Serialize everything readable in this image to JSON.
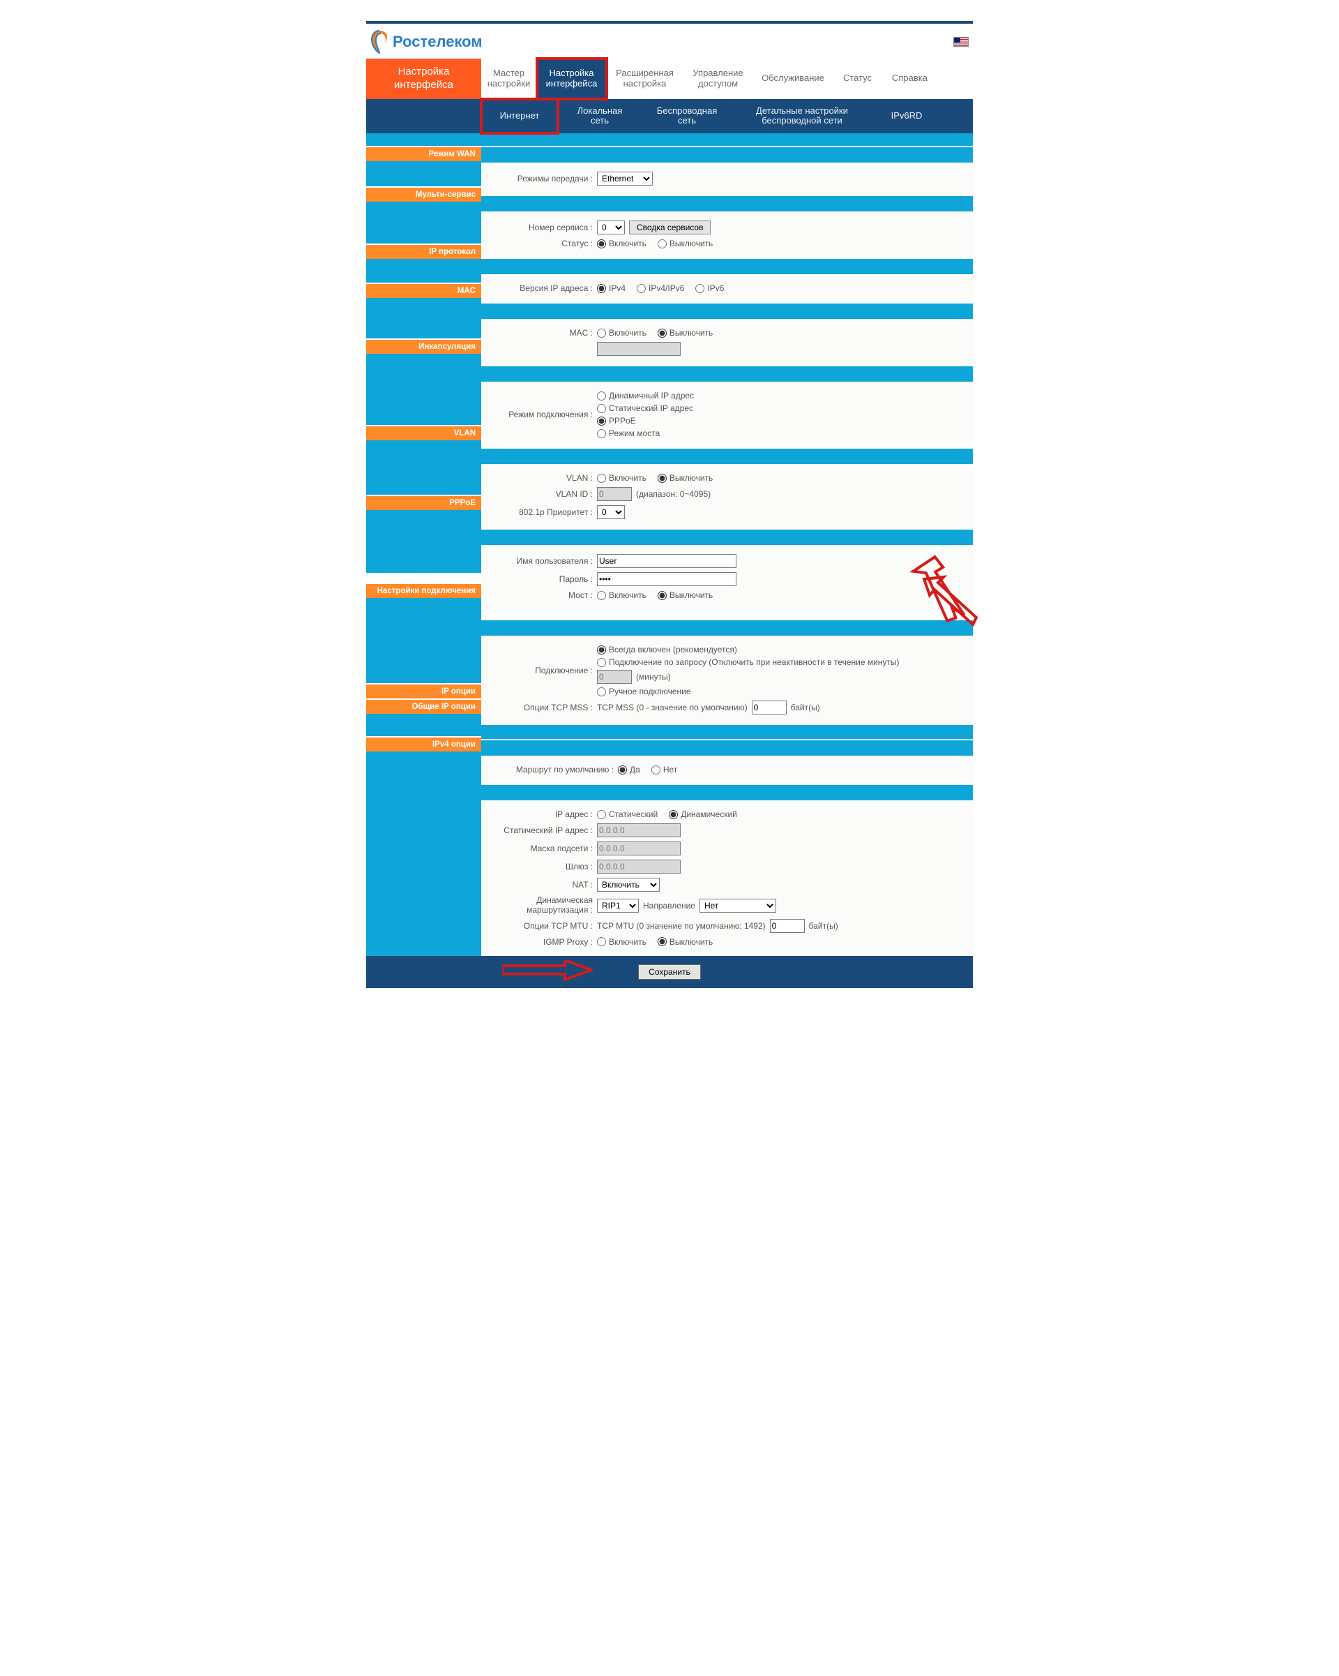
{
  "logo_text": "Ростелеком",
  "left_title_l1": "Настройка",
  "left_title_l2": "интерфейса",
  "main_tabs": {
    "t1_l1": "Мастер",
    "t1_l2": "настройки",
    "t2_l1": "Настройка",
    "t2_l2": "интерфейса",
    "t3_l1": "Расширенная",
    "t3_l2": "настройка",
    "t4_l1": "Управление",
    "t4_l2": "доступом",
    "t5": "Обслуживание",
    "t6": "Статус",
    "t7": "Справка"
  },
  "sub_tabs": {
    "s1": "Интернет",
    "s2_l1": "Локальная",
    "s2_l2": "сеть",
    "s3_l1": "Беспроводная",
    "s3_l2": "сеть",
    "s4_l1": "Детальные настройки",
    "s4_l2": "беспроводной сети",
    "s5": "IPv6RD"
  },
  "sections": {
    "wan": "Режим WAN",
    "multi": "Мульти-сервис",
    "ipproto": "IP протокол",
    "mac": "MAC",
    "encap": "Инкапсуляция",
    "vlan": "VLAN",
    "pppoe": "PPPoE",
    "conn": "Настройки подключения",
    "ipopt": "IP опции",
    "ipopt_common": "Общие IP опции",
    "ipv4opt": "IPv4 опции"
  },
  "labels": {
    "transfer_modes": "Режимы передачи :",
    "service_number": "Номер сервиса :",
    "service_summary_btn": "Сводка сервисов",
    "status": "Статус :",
    "enable": "Включить",
    "disable": "Выключить",
    "ip_version": "Версия IP адреса :",
    "ipv4": "IPv4",
    "ipv4ipv6": "IPv4/IPv6",
    "ipv6": "IPv6",
    "mac": "MAC :",
    "conn_mode": "Режим подключения :",
    "dyn_ip": "Динамичный IP адрес",
    "stat_ip": "Статический IP адрес",
    "pppoe": "PPPoE",
    "bridge_mode": "Режим моста",
    "vlan": "VLAN :",
    "vlan_id": "VLAN ID :",
    "vlan_range": "(диапазон: 0~4095)",
    "priority": "802.1p Приоритет :",
    "username": "Имя пользователя :",
    "password": "Пароль :",
    "bridge": "Мост :",
    "connection": "Подключение :",
    "always_on": "Всегда включен (рекомендуется)",
    "on_demand": "Подключение по запросу (Отключить при неактивности в течение минуты)",
    "minutes_suffix": "(минуты)",
    "manual_conn": "Ручное подключение",
    "tcp_mss_opts": "Опции TCP MSS :",
    "tcp_mss_text": "TCP MSS (0 - значение по умолчанию)",
    "bytes": "байт(ы)",
    "default_route": "Маршрут по умолчанию :",
    "yes": "Да",
    "no": "Нет",
    "ip_addr": "IP адрес :",
    "static": "Статический",
    "dynamic": "Динамический",
    "static_ip_addr": "Статический IP адрес :",
    "subnet_mask": "Маска подсети :",
    "gateway": "Шлюз :",
    "nat": "NAT :",
    "dyn_routing_l1": "Динамическая",
    "dyn_routing_l2": "маршрутизация",
    "direction": "Направление",
    "tcp_mtu_opts": "Опции TCP MTU :",
    "tcp_mtu_text": "TCP MTU (0 значение по умолчанию: 1492)",
    "igmp_proxy": "IGMP Proxy :",
    "save_btn": "Сохранить"
  },
  "values": {
    "transfer_mode_selected": "Ethernet",
    "service_number_selected": "0",
    "priority_selected": "0",
    "vlan_id": "0",
    "username": "User",
    "password": "••••",
    "idle_minutes": "0",
    "tcp_mss": "0",
    "static_ip": "0.0.0.0",
    "subnet": "0.0.0.0",
    "gateway": "0.0.0.0",
    "nat_selected": "Включить",
    "rip_selected": "RIP1",
    "direction_selected": "Нет",
    "tcp_mtu": "0"
  }
}
